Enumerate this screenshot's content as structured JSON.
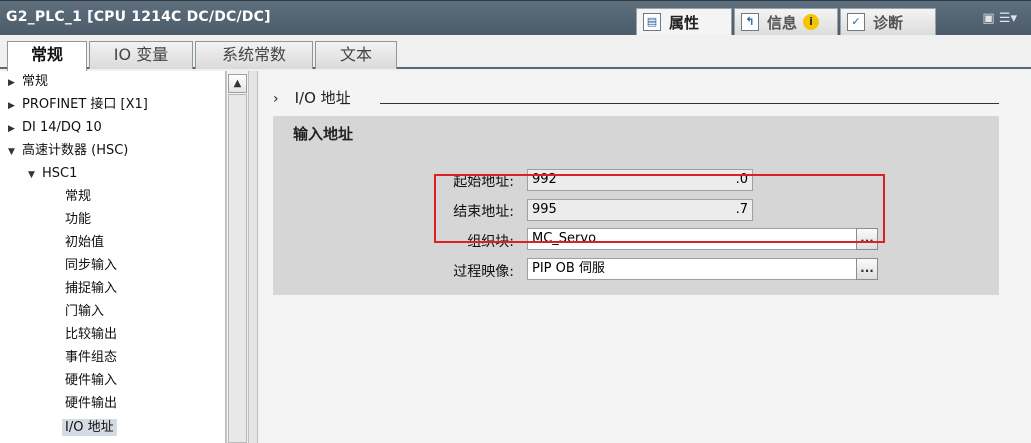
{
  "window": {
    "title": "G2_PLC_1 [CPU 1214C DC/DC/DC]",
    "tabs": [
      {
        "label": "属性",
        "icon": "properties-icon"
      },
      {
        "label": "信息",
        "icon": "info-icon",
        "badge": "i"
      },
      {
        "label": "诊断",
        "icon": "diagnostics-icon"
      }
    ]
  },
  "inner_tabs": [
    "常规",
    "IO 变量",
    "系统常数",
    "文本"
  ],
  "tree": [
    {
      "label": "常规",
      "level": 0,
      "arrow": "▶"
    },
    {
      "label": "PROFINET 接口 [X1]",
      "level": 0,
      "arrow": "▶"
    },
    {
      "label": "DI 14/DQ 10",
      "level": 0,
      "arrow": "▶"
    },
    {
      "label": "高速计数器 (HSC)",
      "level": 0,
      "arrow": "▼"
    },
    {
      "label": "HSC1",
      "level": 1,
      "arrow": "▼"
    },
    {
      "label": "常规",
      "level": 2,
      "arrow": ""
    },
    {
      "label": "功能",
      "level": 2,
      "arrow": ""
    },
    {
      "label": "初始值",
      "level": 2,
      "arrow": ""
    },
    {
      "label": "同步输入",
      "level": 2,
      "arrow": ""
    },
    {
      "label": "捕捉输入",
      "level": 2,
      "arrow": ""
    },
    {
      "label": "门输入",
      "level": 2,
      "arrow": ""
    },
    {
      "label": "比较输出",
      "level": 2,
      "arrow": ""
    },
    {
      "label": "事件组态",
      "level": 2,
      "arrow": ""
    },
    {
      "label": "硬件输入",
      "level": 2,
      "arrow": ""
    },
    {
      "label": "硬件输出",
      "level": 2,
      "arrow": ""
    },
    {
      "label": "I/O 地址",
      "level": 2,
      "arrow": "",
      "selected": true
    }
  ],
  "section": {
    "title": "I/O 地址",
    "group_title": "输入地址",
    "start_label": "起始地址:",
    "start_value": "992",
    "start_bit": ".0",
    "end_label": "结束地址:",
    "end_value": "995",
    "end_bit": ".7",
    "ob_label": "组织块:",
    "ob_value": "MC_Servo",
    "pip_label": "过程映像:",
    "pip_value": "PIP OB 伺服",
    "browse": "..."
  }
}
